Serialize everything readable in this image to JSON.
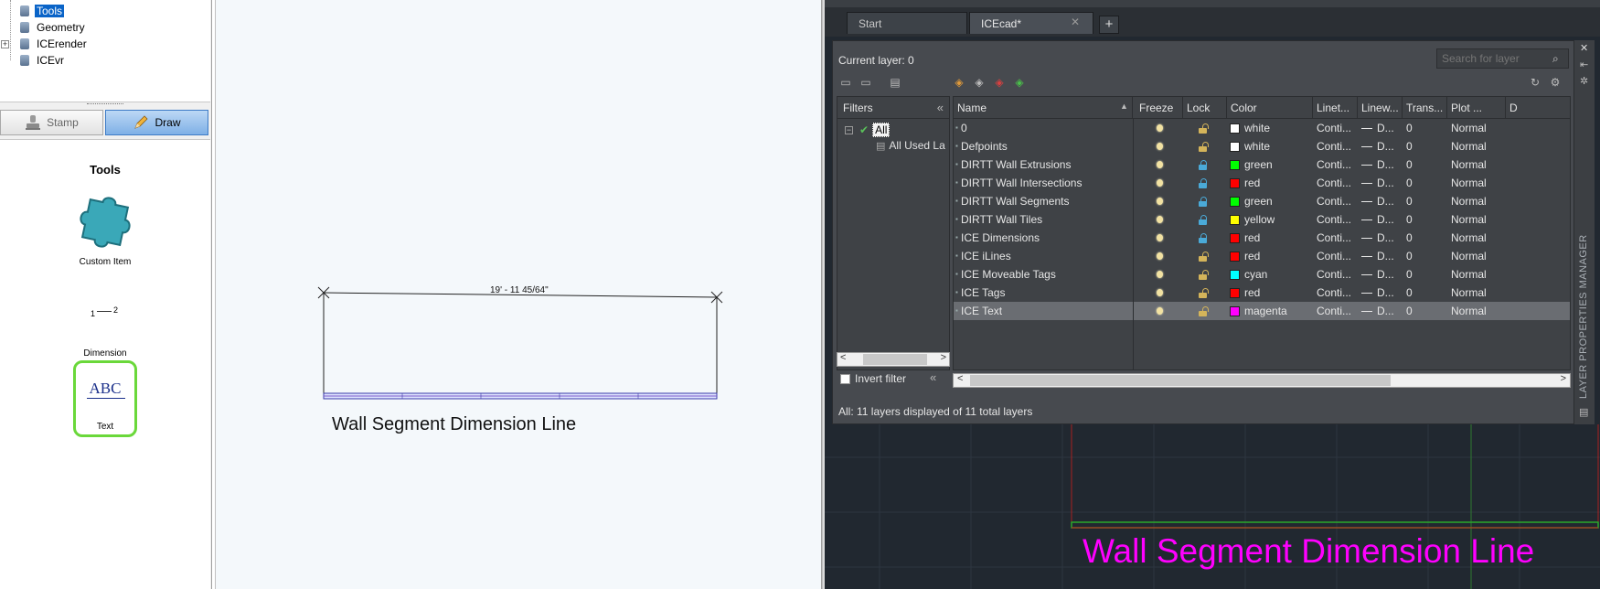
{
  "tree": {
    "items": [
      {
        "label": "Tools",
        "selected": true
      },
      {
        "label": "Geometry",
        "selected": false
      },
      {
        "label": "ICErender",
        "selected": false,
        "expandable": true
      },
      {
        "label": "ICEvr",
        "selected": false
      }
    ]
  },
  "mode_tabs": [
    {
      "label": "Stamp",
      "active": false
    },
    {
      "label": "Draw",
      "active": true
    }
  ],
  "tools": {
    "title": "Tools",
    "items": [
      {
        "label": "Custom Item",
        "icon": "puzzle-icon"
      },
      {
        "label": "Dimension",
        "icon": "dimension-icon",
        "glyph_left": "1",
        "glyph_right": "2"
      },
      {
        "label": "Text",
        "icon": "text-abc-icon",
        "glyph": "ABC"
      }
    ]
  },
  "drawing": {
    "dimension_label": "19' - 11 45/64\"",
    "caption": "Wall Segment Dimension Line"
  },
  "cad": {
    "doc_tabs": [
      {
        "label": "Start",
        "active": false
      },
      {
        "label": "ICEcad*",
        "active": true
      }
    ],
    "add_tab_glyph": "+",
    "close_glyph": "✕",
    "overlay_caption": "Wall Segment Dimension Line",
    "overlay_color": "#ff00ff",
    "side_label": "LAYER PROPERTIES MANAGER"
  },
  "layer_manager": {
    "current_layer": "Current layer: 0",
    "search_placeholder": "Search for layer",
    "filters_title": "Filters",
    "filters": [
      {
        "label": "All"
      },
      {
        "label": "All Used La"
      }
    ],
    "invert_filter_label": "Invert filter",
    "status": "All: 11 layers displayed of 11 total layers",
    "columns": [
      "Name",
      "Freeze",
      "Lock",
      "Color",
      "Linet...",
      "Linew...",
      "Trans...",
      "Plot ...",
      "D"
    ],
    "layers": [
      {
        "name": "0",
        "color_name": "white",
        "color_hex": "#ffffff",
        "linetype": "Conti...",
        "lineweight": "D...",
        "transparency": "0",
        "plot_style": "Normal",
        "locked": false,
        "selected": false
      },
      {
        "name": "Defpoints",
        "color_name": "white",
        "color_hex": "#ffffff",
        "linetype": "Conti...",
        "lineweight": "D...",
        "transparency": "0",
        "plot_style": "Normal",
        "locked": false,
        "selected": false
      },
      {
        "name": "DIRTT Wall Extrusions",
        "color_name": "green",
        "color_hex": "#00ff00",
        "linetype": "Conti...",
        "lineweight": "D...",
        "transparency": "0",
        "plot_style": "Normal",
        "locked": true,
        "selected": false
      },
      {
        "name": "DIRTT Wall Intersections",
        "color_name": "red",
        "color_hex": "#ff0000",
        "linetype": "Conti...",
        "lineweight": "D...",
        "transparency": "0",
        "plot_style": "Normal",
        "locked": true,
        "selected": false
      },
      {
        "name": "DIRTT Wall Segments",
        "color_name": "green",
        "color_hex": "#00ff00",
        "linetype": "Conti...",
        "lineweight": "D...",
        "transparency": "0",
        "plot_style": "Normal",
        "locked": true,
        "selected": false
      },
      {
        "name": "DIRTT Wall Tiles",
        "color_name": "yellow",
        "color_hex": "#ffff00",
        "linetype": "Conti...",
        "lineweight": "D...",
        "transparency": "0",
        "plot_style": "Normal",
        "locked": true,
        "selected": false
      },
      {
        "name": "ICE Dimensions",
        "color_name": "red",
        "color_hex": "#ff0000",
        "linetype": "Conti...",
        "lineweight": "D...",
        "transparency": "0",
        "plot_style": "Normal",
        "locked": true,
        "selected": false
      },
      {
        "name": "ICE iLines",
        "color_name": "red",
        "color_hex": "#ff0000",
        "linetype": "Conti...",
        "lineweight": "D...",
        "transparency": "0",
        "plot_style": "Normal",
        "locked": false,
        "selected": false
      },
      {
        "name": "ICE Moveable Tags",
        "color_name": "cyan",
        "color_hex": "#00ffff",
        "linetype": "Conti...",
        "lineweight": "D...",
        "transparency": "0",
        "plot_style": "Normal",
        "locked": false,
        "selected": false
      },
      {
        "name": "ICE Tags",
        "color_name": "red",
        "color_hex": "#ff0000",
        "linetype": "Conti...",
        "lineweight": "D...",
        "transparency": "0",
        "plot_style": "Normal",
        "locked": false,
        "selected": false
      },
      {
        "name": "ICE Text",
        "color_name": "magenta",
        "color_hex": "#ff00ff",
        "linetype": "Conti...",
        "lineweight": "D...",
        "transparency": "0",
        "plot_style": "Normal",
        "locked": false,
        "selected": true
      }
    ]
  }
}
